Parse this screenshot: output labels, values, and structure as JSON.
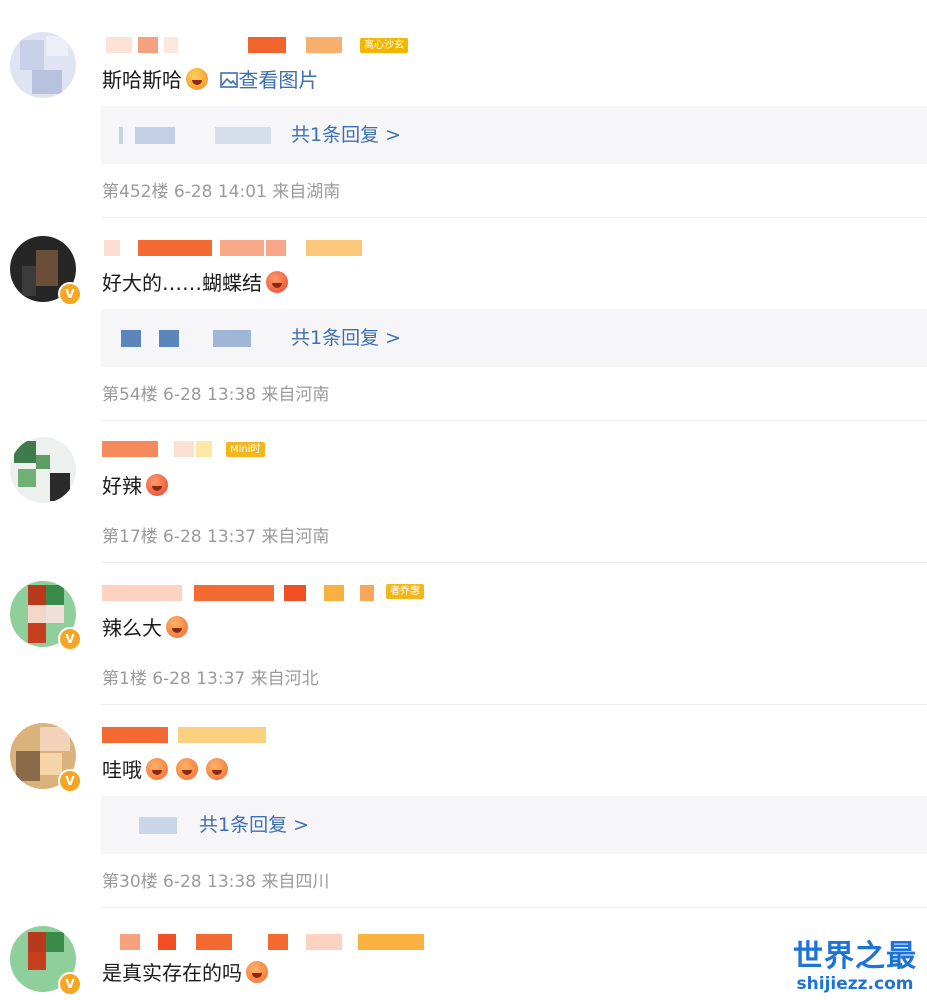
{
  "comments": [
    {
      "text": "斯哈斯哈",
      "link": "查看图片",
      "reply": "共1条回复 >",
      "meta": "第452楼 6-28 14:01 来自湖南",
      "tag": "离心沙玄"
    },
    {
      "text": "好大的……蝴蝶结",
      "reply": "共1条回复 >",
      "meta": "第54楼 6-28 13:38 来自河南"
    },
    {
      "text": "好辣",
      "meta": "第17楼 6-28 13:37 来自河南",
      "tag": "Mini时"
    },
    {
      "text": "辣么大",
      "meta": "第1楼 6-28 13:37 来自河北",
      "tag": "者乔惠"
    },
    {
      "text": "哇哦",
      "reply": "共1条回复 >",
      "meta": "第30楼 6-28 13:38 来自四川"
    },
    {
      "text": "是真实存在的吗"
    }
  ],
  "watermark": {
    "line1": "世界之最",
    "line2": "shijiezz.com"
  },
  "colors": {
    "link": "#3e6fb0",
    "meta": "#9a9a9a",
    "reply_bg": "#f6f6f8",
    "badge": "#f5a623",
    "watermark": "#1e73d8"
  },
  "icons": [
    "image-icon",
    "verified-badge-icon",
    "emoji-icon"
  ]
}
